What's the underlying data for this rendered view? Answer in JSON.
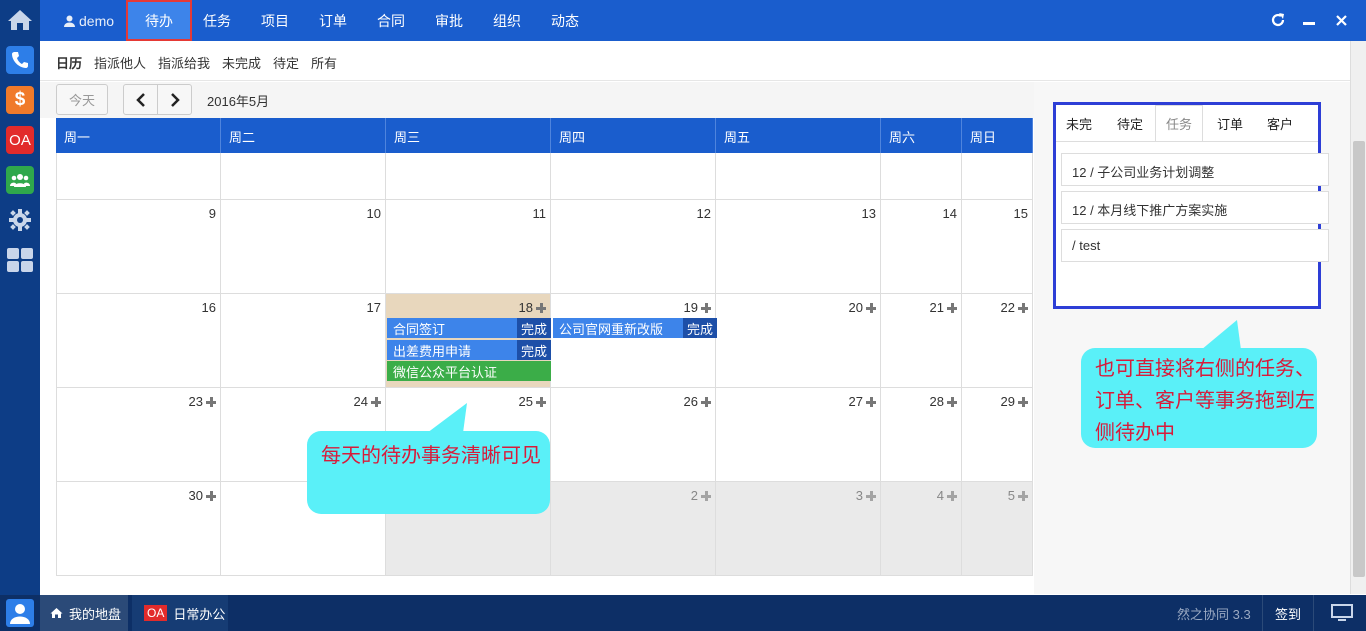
{
  "colors": {
    "accent": "#1a5dcd",
    "dock": "#0d3d86",
    "taskbar": "#0d2f66",
    "callout": "#5af0f8",
    "callout_text": "#d81b3a"
  },
  "dock": {
    "items": [
      "home-icon",
      "phone-icon",
      "dollar-icon",
      "oa-icon",
      "people-icon",
      "gear-icon",
      "grid-icon"
    ],
    "oa_label": "OA"
  },
  "topbar": {
    "user": "demo",
    "nav": [
      "待办",
      "任务",
      "项目",
      "订单",
      "合同",
      "审批",
      "组织",
      "动态"
    ],
    "active": "待办"
  },
  "subnav": [
    "日历",
    "指派他人",
    "指派给我",
    "未完成",
    "待定",
    "所有"
  ],
  "calendar": {
    "today_btn": "今天",
    "month_label": "2016年5月",
    "weekdays": [
      "周一",
      "周二",
      "周三",
      "周四",
      "周五",
      "周六",
      "周日"
    ],
    "rows": [
      [
        "",
        "",
        "",
        "",
        "",
        "",
        ""
      ],
      [
        "9",
        "10",
        "11",
        "12",
        "13",
        "14",
        "15"
      ],
      [
        "16",
        "17",
        "18",
        "19",
        "20",
        "21",
        "22"
      ],
      [
        "23",
        "24",
        "25",
        "26",
        "27",
        "28",
        "29"
      ],
      [
        "30",
        "",
        "",
        "2",
        "3",
        "4",
        "5"
      ]
    ],
    "events": [
      {
        "title": "合同签订",
        "tag": "完成",
        "color": "#3d84ea"
      },
      {
        "title": "出差费用申请",
        "tag": "完成",
        "color": "#3d84ea"
      },
      {
        "title": "微信公众平台认证",
        "tag": "",
        "color": "#3bad48"
      },
      {
        "title": "公司官网重新改版",
        "tag": "完成",
        "color": "#3d84ea"
      }
    ]
  },
  "callouts": {
    "left": "每天的待办事务清晰可见",
    "right": "也可直接将右侧的任务、订单、客户等事务拖到左侧待办中"
  },
  "rightpanel": {
    "tabs": [
      "未完",
      "待定",
      "任务",
      "订单",
      "客户"
    ],
    "active_tab": "任务",
    "items": [
      "12 / 子公司业务计划调整",
      "12 / 本月线下推广方案实施",
      "/ test"
    ]
  },
  "taskbar": {
    "items": [
      "我的地盘",
      "日常办公"
    ],
    "oa_badge": "OA",
    "version": "然之协同 3.3",
    "signin": "签到"
  }
}
